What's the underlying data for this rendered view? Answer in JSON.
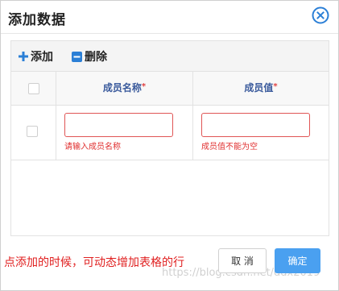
{
  "dialog": {
    "title": "添加数据"
  },
  "toolbar": {
    "add_label": "添加",
    "delete_label": "删除"
  },
  "table": {
    "columns": [
      {
        "label": "成员名称",
        "required": "*"
      },
      {
        "label": "成员值",
        "required": "*"
      }
    ],
    "rows": [
      {
        "name_value": "",
        "name_error": "请输入成员名称",
        "value_value": "",
        "value_error": "成员值不能为空"
      }
    ]
  },
  "footer": {
    "note": "点添加的时候，可动态增加表格的行",
    "cancel_label": "取 消",
    "confirm_label": "确定"
  },
  "watermark": "https://blog.csdn.net/ddx2019",
  "colors": {
    "accent": "#4aa0f0",
    "error": "#e03030",
    "header_text": "#3a5a9c",
    "icon_blue": "#2b7fd6"
  }
}
